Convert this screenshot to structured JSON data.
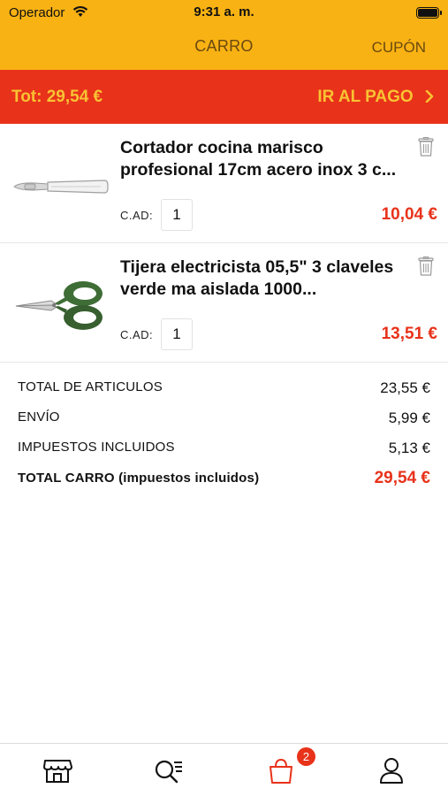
{
  "status_bar": {
    "carrier": "Operador",
    "time": "9:31 a. m."
  },
  "nav": {
    "title": "CARRO",
    "coupon_label": "CUPÓN"
  },
  "checkout": {
    "total_label": "Tot: 29,54 €",
    "pay_label": "IR AL PAGO"
  },
  "items": [
    {
      "title": "Cortador cocina marisco profesional 17cm acero inox 3 c...",
      "qty_label": "C.AD:",
      "qty": "1",
      "price": "10,04 €",
      "image": "knife-icon"
    },
    {
      "title": "Tijera electricista 05,5\" 3 claveles verde ma aislada 1000...",
      "qty_label": "C.AD:",
      "qty": "1",
      "price": "13,51 €",
      "image": "scissors-icon"
    }
  ],
  "summary": [
    {
      "label": "TOTAL DE ARTICULOS",
      "value": "23,55 €"
    },
    {
      "label": "ENVÍO",
      "value": "5,99 €"
    },
    {
      "label": "IMPUESTOS INCLUIDOS",
      "value": "5,13 €"
    },
    {
      "label": "TOTAL CARRO (impuestos incluidos)",
      "value": "29,54 €"
    }
  ],
  "tabbar": {
    "tabs": [
      "store-icon",
      "search-icon",
      "cart-icon",
      "profile-icon"
    ],
    "cart_badge": "2",
    "active_color": "#e8321a"
  },
  "colors": {
    "header": "#f9b213",
    "checkout_bar": "#e8321a",
    "checkout_text": "#f9c233",
    "price": "#e8321a"
  }
}
